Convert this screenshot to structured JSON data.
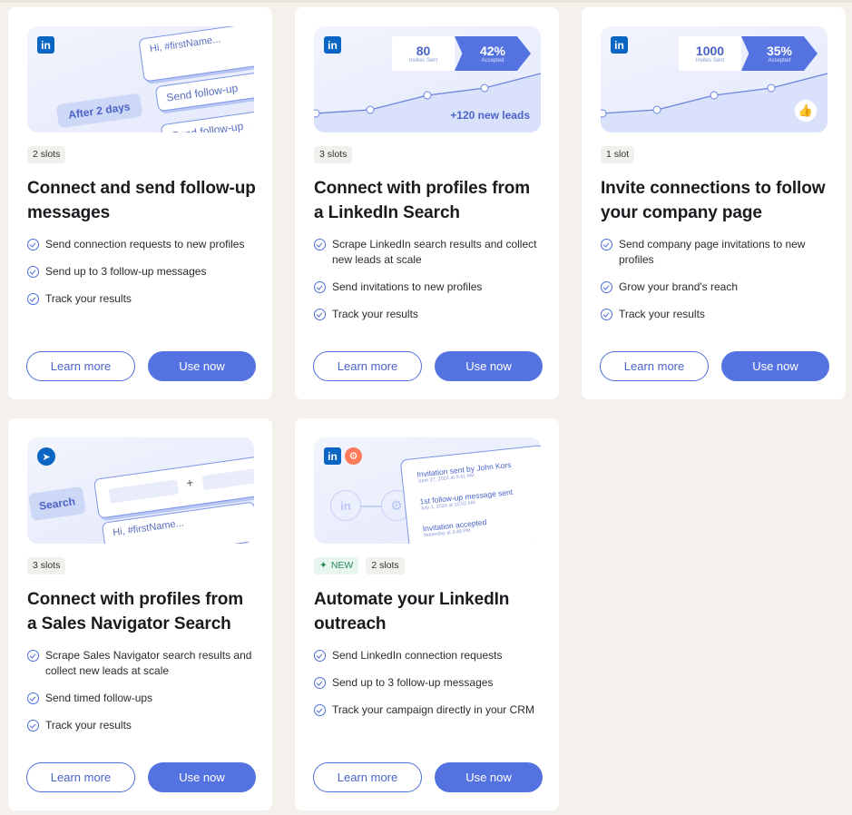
{
  "cards": [
    {
      "slots": "2 slots",
      "title": "Connect and send follow-up messages",
      "features": [
        "Send connection requests to new profiles",
        "Send up to 3 follow-up messages",
        "Track your results"
      ],
      "learn": "Learn more",
      "use": "Use now",
      "illus": {
        "hi": "Hi, #firstName...",
        "follow1": "Send follow-up",
        "delay": "After 2 days",
        "follow2": "Send follow-up"
      }
    },
    {
      "slots": "3 slots",
      "title": "Connect with profiles from a LinkedIn Search",
      "features": [
        "Scrape LinkedIn search results and collect new leads at scale",
        "Send invitations to new profiles",
        "Track your results"
      ],
      "learn": "Learn more",
      "use": "Use now",
      "illus": {
        "invites": "80",
        "invites_label": "Invites Sent",
        "accepted": "42%",
        "accepted_label": "Accepted",
        "leads": "+120 new leads"
      }
    },
    {
      "slots": "1 slot",
      "title": "Invite connections to follow your company page",
      "features": [
        "Send company page invitations to new profiles",
        "Grow your brand's reach",
        "Track your results"
      ],
      "learn": "Learn more",
      "use": "Use now",
      "illus": {
        "invites": "1000",
        "invites_label": "Invites Sent",
        "accepted": "35%",
        "accepted_label": "Accepted"
      }
    },
    {
      "slots": "3 slots",
      "title": "Connect with profiles from a Sales Navigator Search",
      "features": [
        "Scrape Sales Navigator search results and collect new leads at scale",
        "Send timed follow-ups",
        "Track your results"
      ],
      "learn": "Learn more",
      "use": "Use now",
      "illus": {
        "search": "Search",
        "plus": "+",
        "hi": "Hi, #firstName..."
      }
    },
    {
      "new": "NEW",
      "slots": "2 slots",
      "title": "Automate your LinkedIn outreach",
      "features": [
        "Send LinkedIn connection requests",
        "Send up to 3 follow-up messages",
        "Track your campaign directly in your CRM"
      ],
      "learn": "Learn more",
      "use": "Use now",
      "illus": {
        "ev1": "Invitation sent by John Kors",
        "ev1_date": "June 27, 2024 at 9:41 AM",
        "ev2": "1st follow-up message sent",
        "ev2_date": "July 1, 2024 at 10:02 AM",
        "ev3": "Invitation accepted",
        "ev3_date": "Yesterday at 3:48 PM"
      }
    }
  ],
  "colors": {
    "accent": "#5473e0",
    "linkedin": "#0a66c2",
    "hubspot": "#ff7a59",
    "background": "#f4f1ed"
  },
  "icons": {
    "linkedin": "linkedin-icon",
    "hubspot": "hubspot-icon",
    "compass": "sales-navigator-icon",
    "check": "check-circle-icon",
    "like": "thumbs-up-icon",
    "sparkle": "sparkle-icon"
  }
}
